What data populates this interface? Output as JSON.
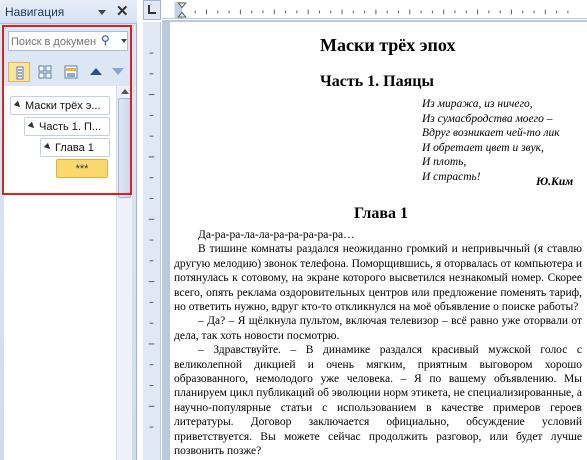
{
  "nav": {
    "title": "Навигация",
    "close_icon": "close-icon",
    "search_placeholder": "Поиск в докумен",
    "tabs": [
      {
        "name": "headings-view-tab",
        "icon": "headings-icon",
        "active": true
      },
      {
        "name": "pages-view-tab",
        "icon": "thumbnails-icon",
        "active": false
      },
      {
        "name": "results-view-tab",
        "icon": "results-icon",
        "active": false
      }
    ],
    "tree": [
      {
        "label": "Маски трёх э...",
        "level": 0
      },
      {
        "label": "Часть 1. П...",
        "level": 1
      },
      {
        "label": "Глава 1",
        "level": 2
      },
      {
        "label": "***",
        "level": 3,
        "active": true
      }
    ]
  },
  "document": {
    "title": "Маски трёх эпох",
    "part_heading": "Часть 1. Паяцы",
    "epigraph": [
      "Из миража, из ничего,",
      "Из сумасбродства моего –",
      "Вдруг возникает чей-то лик",
      "И обретает цвет и звук,",
      "И плоть,",
      "И страсть!"
    ],
    "epigraph_author": "Ю.Ким",
    "chapter_heading": "Глава 1",
    "paragraphs": [
      "Да-ра-ра-ла-ла-ра-ра-ра-ра-ра…",
      "В тишине комнаты раздался неожиданно громкий и непривычный (я ставлю другую мелодию) звонок телефона. Поморщившись, я оторвалась от компьютера и потянулась к сотовому, на экране которого высветился незнакомый номер. Скорее всего, опять реклама оздоровительных центров или предложение поменять тариф, но ответить нужно, вдруг кто-то откликнулся на моё объявление о поиске работы?",
      "– Да? – Я щёлкнула пультом, включая телевизор – всё равно уже оторвали от дела, так хоть новости посмотрю.",
      "– Здравствуйте. – В динамике раздался красивый мужской голос с великолепной дикцией и очень мягким, приятным выговором хорошо образованного, немолодого уже человека. – Я по вашему объявлению. Мы планируем цикл публикаций об эволюции норм этикета, не специализированные, а научно-популярные статьи с использованием в качестве примеров героев литературы. Договор заключается официально, обсуждение условий приветствуется. Вы можете сейчас продолжить разговор, или будет лучше позвонить позже?"
    ]
  }
}
